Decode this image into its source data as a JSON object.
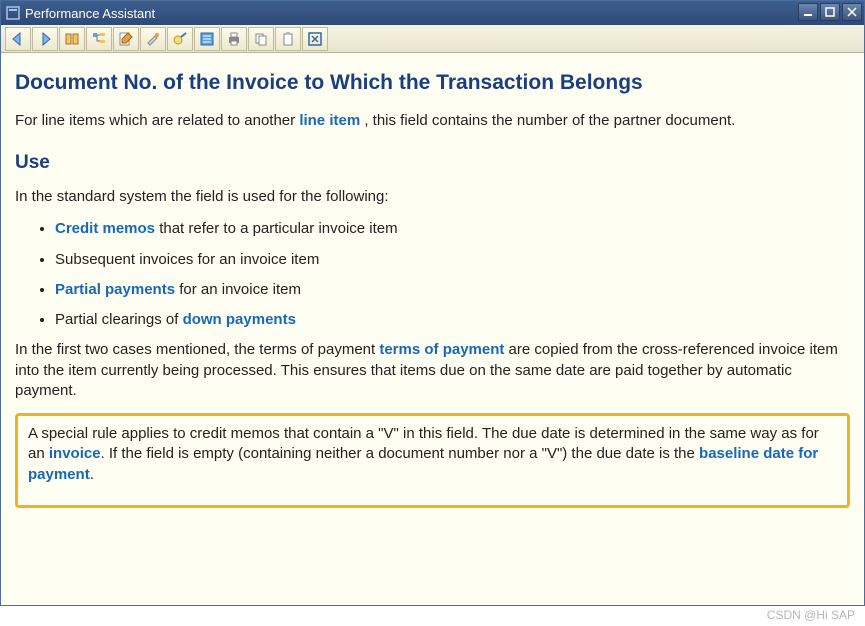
{
  "window": {
    "title": "Performance Assistant"
  },
  "toolbar": {
    "icons": [
      "back-icon",
      "forward-icon",
      "book-icon",
      "tree-icon",
      "edit-icon",
      "brush-icon",
      "help-icon",
      "list-icon",
      "print-icon",
      "copy-icon",
      "clipboard-icon",
      "close-box-icon"
    ]
  },
  "content": {
    "h1": "Document No. of the Invoice to Which the Transaction Belongs",
    "intro_before": "For line items which are related to another ",
    "intro_link": "line item",
    "intro_after": " , this field contains the number of the partner document.",
    "use_heading": "Use",
    "use_intro": "In the standard system the field is used for the following:",
    "bullets": {
      "b1_link": "Credit memos",
      "b1_after": " that refer to a particular invoice item",
      "b2": "Subsequent invoices for an invoice item",
      "b3_link": "Partial payments",
      "b3_after": " for an invoice item",
      "b4_before": "Partial clearings of ",
      "b4_link": "down payments"
    },
    "para2_before": "In the first two cases mentioned, the terms of payment ",
    "para2_link": "terms of payment",
    "para2_after": " are copied from the cross-referenced invoice item into the item currently being processed. This ensures that items due on the same date are paid together by automatic payment.",
    "box": {
      "t1": "A special rule applies to credit memos that contain a \"V\" in this field. The due date is determined in the same way as for an ",
      "link1": "invoice",
      "t2": ". If the field is empty (containing neither a document number nor a \"V\") the due date is the ",
      "link2": "baseline date for payment",
      "t3": "."
    }
  },
  "watermark": "CSDN @Hi SAP"
}
